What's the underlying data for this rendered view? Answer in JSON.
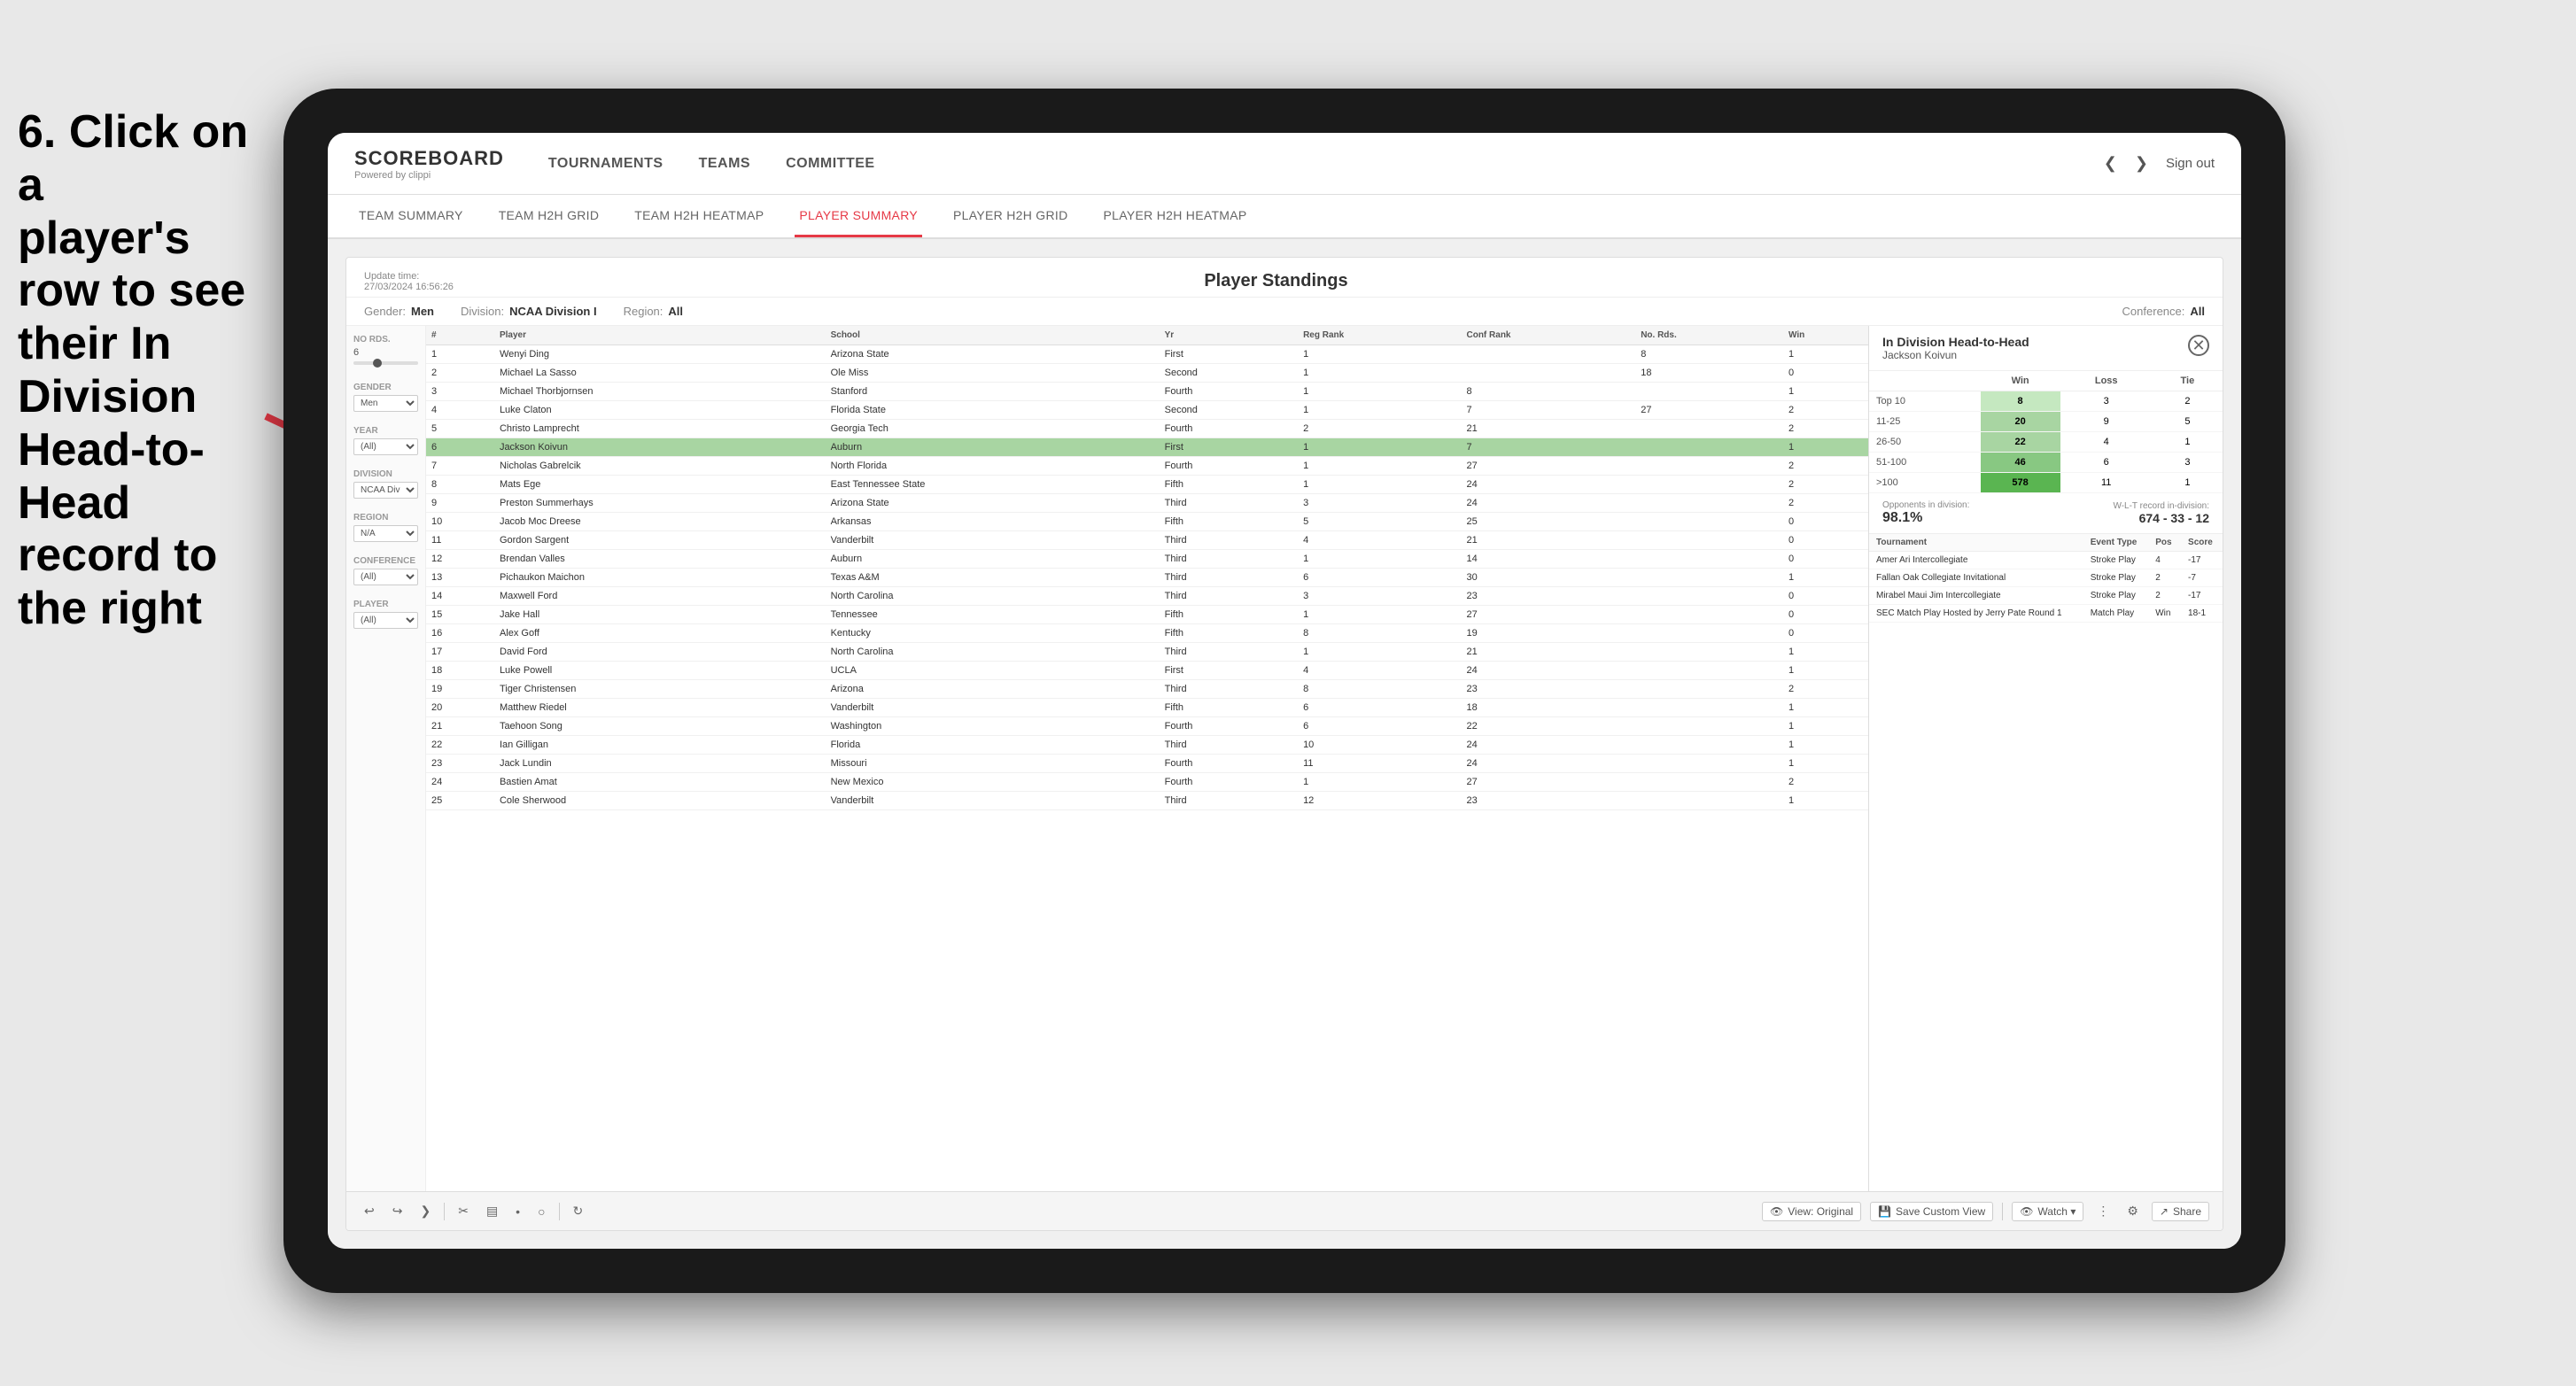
{
  "instruction": {
    "line1": "6. Click on a",
    "line2": "player's row to see",
    "line3": "their In Division",
    "line4": "Head-to-Head",
    "line5": "record to the right"
  },
  "nav": {
    "logo": "SCOREBOARD",
    "logo_sub": "Powered by clippi",
    "items": [
      "TOURNAMENTS",
      "TEAMS",
      "COMMITTEE"
    ],
    "sign_out": "Sign out"
  },
  "sub_nav": {
    "items": [
      "TEAM SUMMARY",
      "TEAM H2H GRID",
      "TEAM H2H HEATMAP",
      "PLAYER SUMMARY",
      "PLAYER H2H GRID",
      "PLAYER H2H HEATMAP"
    ],
    "active": "PLAYER SUMMARY"
  },
  "panel": {
    "title": "Player Standings",
    "update_time": "Update time:",
    "update_value": "27/03/2024 16:56:26",
    "filters": {
      "gender_label": "Gender:",
      "gender_value": "Men",
      "division_label": "Division:",
      "division_value": "NCAA Division I",
      "region_label": "Region:",
      "region_value": "All",
      "conference_label": "Conference:",
      "conference_value": "All"
    }
  },
  "sidebar": {
    "no_rds_label": "No Rds.",
    "no_rds_value": "6",
    "gender_label": "Gender",
    "gender_value": "Men",
    "year_label": "Year",
    "year_value": "(All)",
    "division_label": "Division",
    "division_value": "NCAA Division I",
    "region_label": "Region",
    "region_value": "N/A",
    "conference_label": "Conference",
    "conference_value": "(All)",
    "player_label": "Player",
    "player_value": "(All)"
  },
  "table": {
    "headers": [
      "#",
      "Player",
      "School",
      "Yr",
      "Reg Rank",
      "Conf Rank",
      "No. Rds.",
      "Win"
    ],
    "rows": [
      {
        "rank": 1,
        "player": "Wenyi Ding",
        "school": "Arizona State",
        "year": "First",
        "reg_rank": 1,
        "conf_rank": "",
        "no_rds": 8,
        "win": 1
      },
      {
        "rank": 2,
        "player": "Michael La Sasso",
        "school": "Ole Miss",
        "year": "Second",
        "reg_rank": 1,
        "conf_rank": "",
        "no_rds": 18,
        "win": 0
      },
      {
        "rank": 3,
        "player": "Michael Thorbjornsen",
        "school": "Stanford",
        "year": "Fourth",
        "reg_rank": 1,
        "conf_rank": 8,
        "no_rds": "",
        "win": 1
      },
      {
        "rank": 4,
        "player": "Luke Claton",
        "school": "Florida State",
        "year": "Second",
        "reg_rank": 1,
        "conf_rank": 7,
        "no_rds": 27,
        "win": 2
      },
      {
        "rank": 5,
        "player": "Christo Lamprecht",
        "school": "Georgia Tech",
        "year": "Fourth",
        "reg_rank": 2,
        "conf_rank": 21,
        "no_rds": "",
        "win": 2
      },
      {
        "rank": 6,
        "player": "Jackson Koivun",
        "school": "Auburn",
        "year": "First",
        "reg_rank": 1,
        "conf_rank": 7,
        "no_rds": "",
        "win": 1,
        "highlighted": true
      },
      {
        "rank": 7,
        "player": "Nicholas Gabrelcik",
        "school": "North Florida",
        "year": "Fourth",
        "reg_rank": 1,
        "conf_rank": 27,
        "no_rds": "",
        "win": 2
      },
      {
        "rank": 8,
        "player": "Mats Ege",
        "school": "East Tennessee State",
        "year": "Fifth",
        "reg_rank": 1,
        "conf_rank": 24,
        "no_rds": "",
        "win": 2
      },
      {
        "rank": 9,
        "player": "Preston Summerhays",
        "school": "Arizona State",
        "year": "Third",
        "reg_rank": 3,
        "conf_rank": 24,
        "no_rds": "",
        "win": 2
      },
      {
        "rank": 10,
        "player": "Jacob Moc Dreese",
        "school": "Arkansas",
        "year": "Fifth",
        "reg_rank": 5,
        "conf_rank": 25,
        "no_rds": "",
        "win": 0
      },
      {
        "rank": 11,
        "player": "Gordon Sargent",
        "school": "Vanderbilt",
        "year": "Third",
        "reg_rank": 4,
        "conf_rank": 21,
        "no_rds": "",
        "win": 0
      },
      {
        "rank": 12,
        "player": "Brendan Valles",
        "school": "Auburn",
        "year": "Third",
        "reg_rank": 1,
        "conf_rank": 14,
        "no_rds": "",
        "win": 0
      },
      {
        "rank": 13,
        "player": "Pichaukon Maichon",
        "school": "Texas A&M",
        "year": "Third",
        "reg_rank": 6,
        "conf_rank": 30,
        "no_rds": "",
        "win": 1
      },
      {
        "rank": 14,
        "player": "Maxwell Ford",
        "school": "North Carolina",
        "year": "Third",
        "reg_rank": 3,
        "conf_rank": 23,
        "no_rds": "",
        "win": 0
      },
      {
        "rank": 15,
        "player": "Jake Hall",
        "school": "Tennessee",
        "year": "Fifth",
        "reg_rank": 1,
        "conf_rank": 27,
        "no_rds": "",
        "win": 0
      },
      {
        "rank": 16,
        "player": "Alex Goff",
        "school": "Kentucky",
        "year": "Fifth",
        "reg_rank": 8,
        "conf_rank": 19,
        "no_rds": "",
        "win": 0
      },
      {
        "rank": 17,
        "player": "David Ford",
        "school": "North Carolina",
        "year": "Third",
        "reg_rank": 1,
        "conf_rank": 21,
        "no_rds": "",
        "win": 1
      },
      {
        "rank": 18,
        "player": "Luke Powell",
        "school": "UCLA",
        "year": "First",
        "reg_rank": 4,
        "conf_rank": 24,
        "no_rds": "",
        "win": 1
      },
      {
        "rank": 19,
        "player": "Tiger Christensen",
        "school": "Arizona",
        "year": "Third",
        "reg_rank": 8,
        "conf_rank": 23,
        "no_rds": "",
        "win": 2
      },
      {
        "rank": 20,
        "player": "Matthew Riedel",
        "school": "Vanderbilt",
        "year": "Fifth",
        "reg_rank": 6,
        "conf_rank": 18,
        "no_rds": "",
        "win": 1
      },
      {
        "rank": 21,
        "player": "Taehoon Song",
        "school": "Washington",
        "year": "Fourth",
        "reg_rank": 6,
        "conf_rank": 22,
        "no_rds": "",
        "win": 1
      },
      {
        "rank": 22,
        "player": "Ian Gilligan",
        "school": "Florida",
        "year": "Third",
        "reg_rank": 10,
        "conf_rank": 24,
        "no_rds": "",
        "win": 1
      },
      {
        "rank": 23,
        "player": "Jack Lundin",
        "school": "Missouri",
        "year": "Fourth",
        "reg_rank": 11,
        "conf_rank": 24,
        "no_rds": "",
        "win": 1
      },
      {
        "rank": 24,
        "player": "Bastien Amat",
        "school": "New Mexico",
        "year": "Fourth",
        "reg_rank": 1,
        "conf_rank": 27,
        "no_rds": "",
        "win": 2
      },
      {
        "rank": 25,
        "player": "Cole Sherwood",
        "school": "Vanderbilt",
        "year": "Third",
        "reg_rank": 12,
        "conf_rank": 23,
        "no_rds": "",
        "win": 1
      }
    ]
  },
  "h2h_panel": {
    "title": "In Division Head-to-Head",
    "player_name": "Jackson Koivun",
    "h2h_headers": [
      "",
      "Win",
      "Loss",
      "Tie"
    ],
    "h2h_rows": [
      {
        "range": "Top 10",
        "win": 8,
        "loss": 3,
        "tie": 2
      },
      {
        "range": "11-25",
        "win": 20,
        "loss": 9,
        "tie": 5
      },
      {
        "range": "26-50",
        "win": 22,
        "loss": 4,
        "tie": 1
      },
      {
        "range": "51-100",
        "win": 46,
        "loss": 6,
        "tie": 3
      },
      {
        "range": ">100",
        "win": 578,
        "loss": 11,
        "tie": 1
      }
    ],
    "opponents_label": "Opponents in division:",
    "opponents_pct": "98.1%",
    "wl_label": "W-L-T record in-division:",
    "wl_record": "674 - 33 - 12",
    "tournament_headers": [
      "Tournament",
      "Event Type",
      "Pos",
      "Score"
    ],
    "tournament_rows": [
      {
        "tournament": "Amer Ari Intercollegiate",
        "event_type": "Stroke Play",
        "pos": 4,
        "score": "-17"
      },
      {
        "tournament": "Fallan Oak Collegiate Invitational",
        "event_type": "Stroke Play",
        "pos": 2,
        "score": "-7"
      },
      {
        "tournament": "Mirabel Maui Jim Intercollegiate",
        "event_type": "Stroke Play",
        "pos": 2,
        "score": "-17"
      },
      {
        "tournament": "SEC Match Play Hosted by Jerry Pate Round 1",
        "event_type": "Match Play",
        "pos": "Win",
        "score": "18-1"
      }
    ]
  },
  "toolbar": {
    "undo": "↩",
    "redo": "↪",
    "view_original": "View: Original",
    "save_custom": "Save Custom View",
    "watch": "Watch ▾",
    "share": "Share"
  }
}
